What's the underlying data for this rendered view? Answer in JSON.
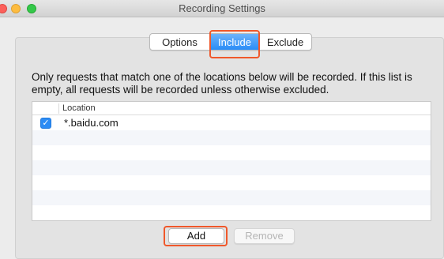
{
  "window": {
    "title": "Recording Settings"
  },
  "tabs": [
    {
      "label": "Options",
      "selected": false
    },
    {
      "label": "Include",
      "selected": true
    },
    {
      "label": "Exclude",
      "selected": false
    }
  ],
  "description": "Only requests that match one of the locations below will be recorded. If this list is empty, all requests will be recorded unless otherwise excluded.",
  "table": {
    "column_header": "Location",
    "rows": [
      {
        "checked": true,
        "location": "*.baidu.com"
      }
    ]
  },
  "buttons": {
    "add_label": "Add",
    "remove_label": "Remove"
  },
  "colors": {
    "accent": "#2a8cf7",
    "highlight": "#f0582b"
  }
}
